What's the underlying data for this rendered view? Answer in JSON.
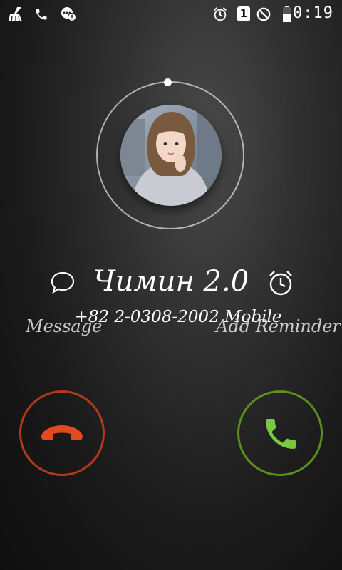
{
  "status_bar": {
    "time": "0:19",
    "sim_slot": "1",
    "icons": [
      "cleaner-icon",
      "phone-icon",
      "notification-icon",
      "alarm-icon",
      "sim-icon",
      "do-not-disturb-icon",
      "battery-icon"
    ]
  },
  "caller": {
    "name": "Чимин 2.0",
    "number": "+82 2-0308-2002 Mobile"
  },
  "actions": {
    "message_label": "Message",
    "reminder_label": "Add Reminder"
  },
  "colors": {
    "decline": "#e04a1e",
    "decline_ring": "#b23a1c",
    "answer": "#7bc843",
    "answer_ring": "#5a8f1e"
  }
}
